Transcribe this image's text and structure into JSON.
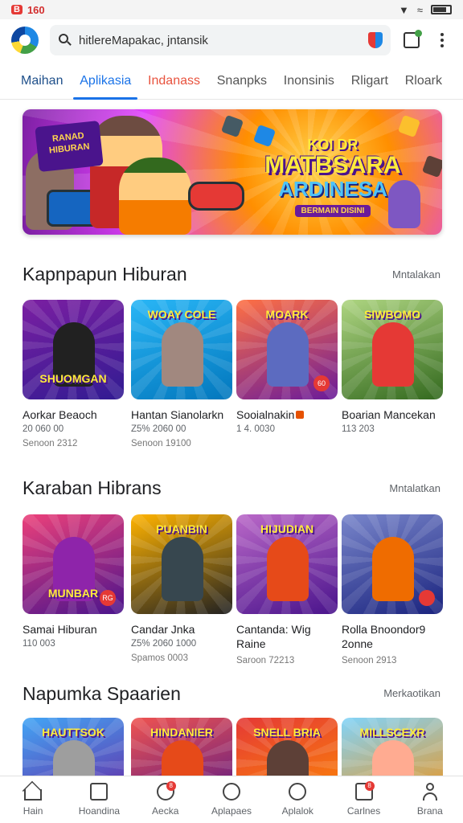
{
  "status_bar": {
    "time": "160",
    "badge": "B"
  },
  "top_bar": {
    "search_value": "hitlereMapakac, jntansik"
  },
  "tabs": [
    {
      "label": "Maihan"
    },
    {
      "label": "Aplikasia"
    },
    {
      "label": "Indanass"
    },
    {
      "label": "Snanpks"
    },
    {
      "label": "Inonsinis"
    },
    {
      "label": "Rligart"
    },
    {
      "label": "Rloark"
    }
  ],
  "banner": {
    "tag_line1": "RANAD",
    "tag_line2": "HIBURAN",
    "title_small": "KOI DR",
    "title_big": "MATBSARA",
    "title_mid": "ARDINESA",
    "subtitle": "BERMAIN DISINI"
  },
  "sections": [
    {
      "title": "Kapnpapun Hiburan",
      "more": "Mntalakan",
      "cards": [
        {
          "thumb_word": "SHUOMGAN",
          "title": "Aorkar Beaoch",
          "line1": "20 060 00",
          "line2": "Senoon 2312",
          "color_a": "#7b1fa2",
          "color_b": "#311b92",
          "char_color": "#212121"
        },
        {
          "thumb_word": "WOAY COLE",
          "title": "Hantan Sianolarkn",
          "line1": "Z5% 2060 00",
          "line2": "Senoon 19100",
          "color_a": "#29b6f6",
          "color_b": "#0277bd",
          "char_color": "#a1887f"
        },
        {
          "thumb_word": "MOARK",
          "title": "Sooialnakin",
          "line1": "1 4. 0030",
          "line2": "",
          "badge": "60",
          "color_a": "#ff7043",
          "color_b": "#6a1b9a",
          "char_color": "#5c6bc0"
        },
        {
          "thumb_word": "SIWBOMO",
          "title": "Boarian Mancekan",
          "line1": "113 203",
          "line2": "",
          "color_a": "#aed581",
          "color_b": "#33691e",
          "char_color": "#e53935"
        }
      ]
    },
    {
      "title": "Karaban Hibrans",
      "more": "Mntalatkan",
      "cards": [
        {
          "thumb_word": "MUNBAR",
          "title": "Samai Hiburan",
          "line1": "110 003",
          "line2": "",
          "badge": "RG",
          "color_a": "#ec407a",
          "color_b": "#4a148c",
          "char_color": "#8e24aa"
        },
        {
          "thumb_word": "PUANBIN",
          "title": "Candar Jnka",
          "line1": "Z5% 2060 1000",
          "line2": "Spamos 0003",
          "color_a": "#ffb300",
          "color_b": "#212121",
          "char_color": "#37474f"
        },
        {
          "thumb_word": "HIJUDIAN",
          "title": "Cantanda: Wig Raine",
          "line1": "",
          "line2": "Saroon 72213",
          "color_a": "#ba68c8",
          "color_b": "#4a148c",
          "char_color": "#e64a19"
        },
        {
          "thumb_word": "",
          "title": "Rolla Bnoondor9 2onne",
          "line1": "",
          "line2": "Senoon 2913",
          "badge": "",
          "color_a": "#7986cb",
          "color_b": "#1a237e",
          "char_color": "#ef6c00"
        }
      ]
    },
    {
      "title": "Napumka Spaarien",
      "more": "Merkaotikan",
      "cards": [
        {
          "thumb_word": "HAUTTSOK",
          "color_a": "#42a5f5",
          "color_b": "#6a1b9a",
          "char_color": "#9e9e9e"
        },
        {
          "thumb_word": "HINDANIER",
          "color_a": "#ef5350",
          "color_b": "#4a148c",
          "char_color": "#e64a19"
        },
        {
          "thumb_word": "SNELL BRIA",
          "color_a": "#e53935",
          "color_b": "#ff8f00",
          "char_color": "#5d4037"
        },
        {
          "thumb_word": "MILLSCEXR",
          "color_a": "#81d4fa",
          "color_b": "#fb8c00",
          "char_color": "#ffab91"
        }
      ]
    }
  ],
  "bottom_nav": [
    {
      "label": "Hain"
    },
    {
      "label": "Hoandina"
    },
    {
      "label": "Aecka",
      "dot": "8"
    },
    {
      "label": "Aplapaes"
    },
    {
      "label": "Aplalok"
    },
    {
      "label": "Carlnes",
      "dot": "8"
    },
    {
      "label": "Brana"
    }
  ]
}
